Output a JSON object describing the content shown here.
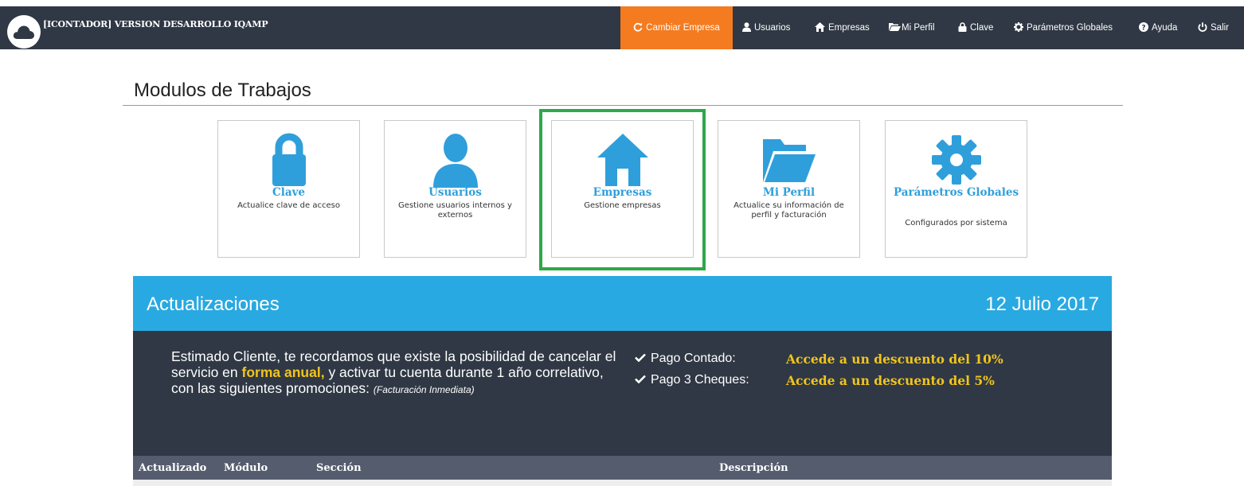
{
  "app": {
    "title": "[ICONTADOR] VERSION DESARROLLO IQAMP"
  },
  "nav": {
    "cambiar_empresa": "Cambiar Empresa",
    "usuarios": "Usuarios",
    "empresas": "Empresas",
    "mi_perfil": "Mi Perfil",
    "clave": "Clave",
    "parametros": "Parámetros Globales",
    "ayuda": "Ayuda",
    "salir": "Salir",
    "active_color": "#f47b20"
  },
  "page": {
    "title": "Modulos de Trabajos"
  },
  "modules": [
    {
      "name": "Clave",
      "desc": "Actualice clave de acceso",
      "icon": "lock-icon"
    },
    {
      "name": "Usuarios",
      "desc": "Gestione usuarios internos y externos",
      "icon": "user-icon"
    },
    {
      "name": "Empresas",
      "desc": "Gestione empresas",
      "icon": "home-icon"
    },
    {
      "name": "Mi Perfil",
      "desc": "Actualice su información de perfil y facturación",
      "icon": "folder-open-icon"
    },
    {
      "name": "Parámetros Globales",
      "desc": "Configurados por sistema",
      "icon": "gear-icon"
    }
  ],
  "updates": {
    "title": "Actualizaciones",
    "date": "12 Julio 2017",
    "message": {
      "part1": "Estimado Cliente, te recordamos que existe la posibilidad de cancelar el servicio en ",
      "highlight": "forma anual,",
      "part2": " y activar tu cuenta durante 1 año correlativo, con las siguientes promociones: ",
      "note": "(Facturación Inmediata)"
    },
    "promos": [
      {
        "label": "Pago Contado:",
        "value": "Accede a un descuento del 10%"
      },
      {
        "label": "Pago 3 Cheques:",
        "value": "Accede a un descuento del 5%"
      }
    ],
    "header_color": "#29a9e1",
    "body_color": "#2f3844",
    "highlight_color": "#f2c41c"
  },
  "table": {
    "columns": [
      "Actualizado",
      "Módulo",
      "Sección",
      "Descripción"
    ]
  }
}
